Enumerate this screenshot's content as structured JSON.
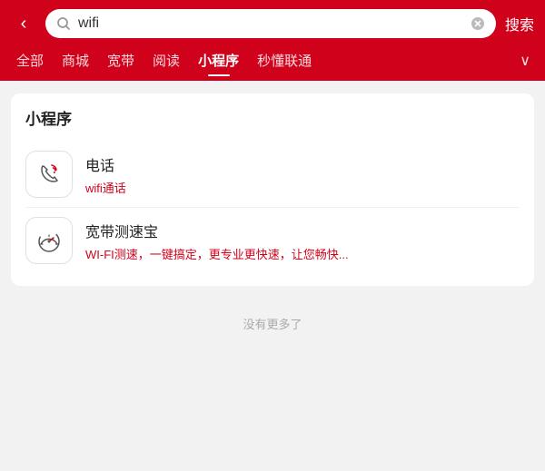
{
  "header": {
    "back_label": "‹",
    "search_value": "wifi",
    "clear_icon": "✕",
    "search_btn_label": "搜索"
  },
  "nav": {
    "tabs": [
      {
        "label": "全部",
        "active": false
      },
      {
        "label": "商城",
        "active": false
      },
      {
        "label": "宽带",
        "active": false
      },
      {
        "label": "阅读",
        "active": false
      },
      {
        "label": "小程序",
        "active": true
      },
      {
        "label": "秒懂联通",
        "active": false
      }
    ],
    "more_icon": "∨"
  },
  "section": {
    "title": "小程序",
    "items": [
      {
        "icon": "📞",
        "title": "电话",
        "subtitle": "wifi通话"
      },
      {
        "icon": "⏱",
        "title": "宽带测速宝",
        "subtitle": "WI-FI测速，一键搞定，更专业更快速，让您畅快..."
      }
    ]
  },
  "footer": {
    "no_more_label": "没有更多了"
  }
}
